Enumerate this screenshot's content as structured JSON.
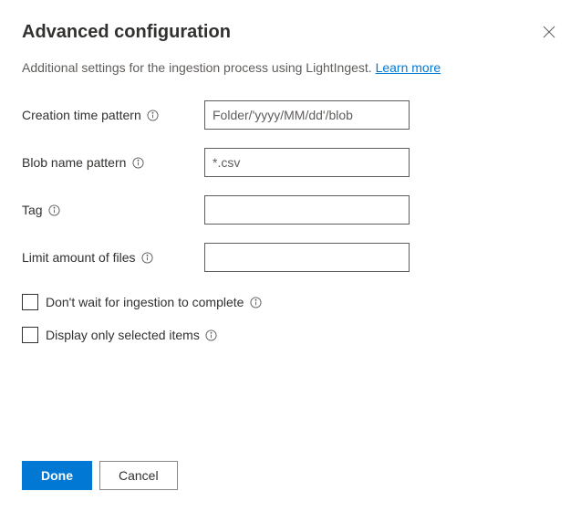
{
  "header": {
    "title": "Advanced configuration"
  },
  "subtitle": {
    "text": "Additional settings for the ingestion process using LightIngest. ",
    "link": "Learn more"
  },
  "fields": {
    "creationTimePattern": {
      "label": "Creation time pattern",
      "placeholder": "Folder/'yyyy/MM/dd'/blob",
      "value": ""
    },
    "blobNamePattern": {
      "label": "Blob name pattern",
      "placeholder": "*.csv",
      "value": ""
    },
    "tag": {
      "label": "Tag",
      "placeholder": "",
      "value": ""
    },
    "limitFiles": {
      "label": "Limit amount of files",
      "placeholder": "",
      "value": ""
    }
  },
  "checkboxes": {
    "dontWait": {
      "label": "Don't wait for ingestion to complete"
    },
    "displaySelected": {
      "label": "Display only selected items"
    }
  },
  "buttons": {
    "done": "Done",
    "cancel": "Cancel"
  }
}
